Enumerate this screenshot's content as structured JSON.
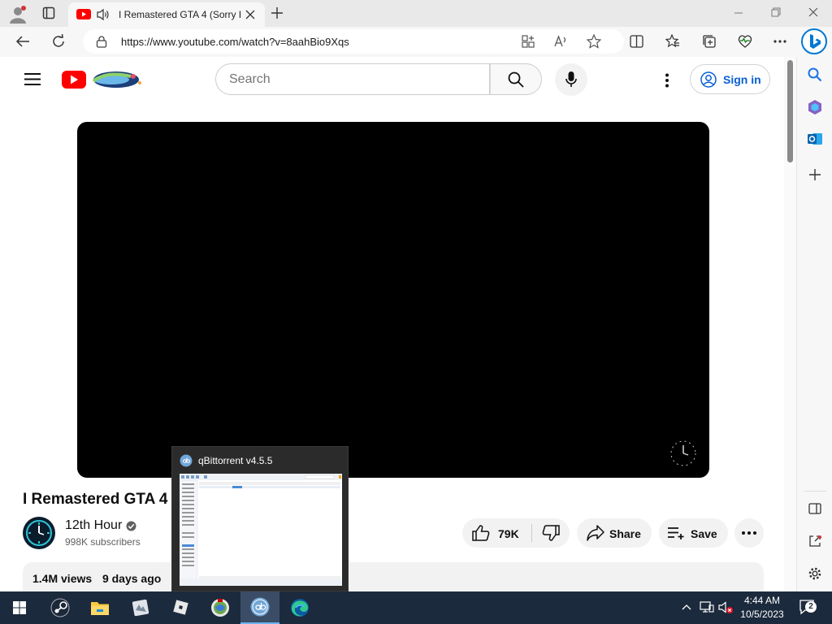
{
  "browser": {
    "tab": {
      "title": "I Remastered GTA 4 (Sorry R"
    },
    "url": "https://www.youtube.com/watch?v=8aahBio9Xqs"
  },
  "youtube": {
    "search_placeholder": "Search",
    "signin_label": "Sign in",
    "video": {
      "title": "I Remastered GTA 4 (S",
      "channel_name": "12th Hour",
      "subscribers": "998K subscribers",
      "likes": "79K",
      "share_label": "Share",
      "save_label": "Save",
      "views": "1.4M views",
      "age": "9 days ago"
    }
  },
  "taskbar_preview": {
    "title": "qBittorrent v4.5.5"
  },
  "clock": {
    "time": "4:44 AM",
    "date": "10/5/2023"
  },
  "notifications": {
    "count": "2"
  },
  "colors": {
    "youtube_red": "#ff0000",
    "link_blue": "#065fd4",
    "taskbar": "#1c2a3d",
    "edge_blue": "#0078d4"
  },
  "icons": [
    "profile-icon",
    "tab-actions-icon",
    "youtube-favicon",
    "audio-playing-icon",
    "close-icon",
    "new-tab-icon",
    "minimize-icon",
    "restore-icon",
    "back-icon",
    "refresh-icon",
    "lock-icon",
    "apps-icon",
    "read-aloud-icon",
    "favorite-star-icon",
    "split-screen-icon",
    "favorites-icon",
    "collections-icon",
    "browser-essentials-icon",
    "more-icon",
    "bing-copilot-icon",
    "hamburger-icon",
    "search-icon",
    "mic-icon",
    "kebab-icon",
    "user-icon",
    "verified-icon",
    "like-icon",
    "dislike-icon",
    "share-icon",
    "save-icon",
    "windows-start-icon",
    "steam-icon",
    "file-explorer-icon",
    "roblox-icon",
    "qbittorrent-icon",
    "edge-icon",
    "chevron-up-icon",
    "network-icon",
    "volume-muted-icon",
    "notification-icon"
  ]
}
